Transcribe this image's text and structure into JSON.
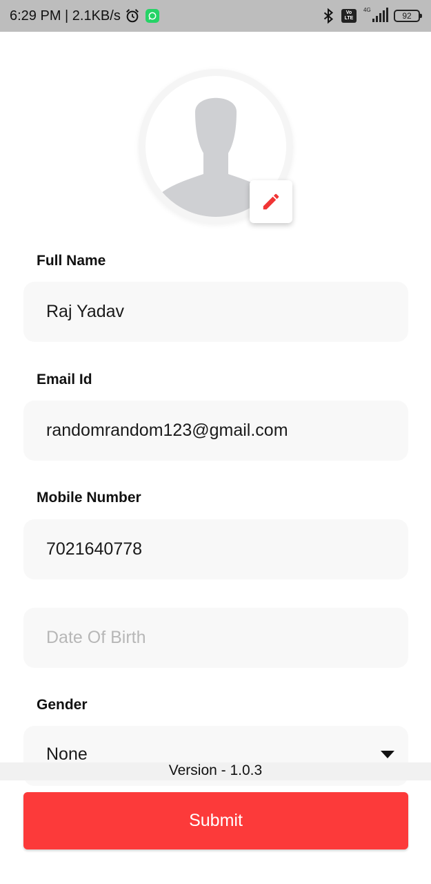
{
  "status_bar": {
    "time_speed": "6:29 PM | 2.1KB/s",
    "network_type": "4G",
    "volte_top": "Vo",
    "volte_bottom": "LTE",
    "battery": "92",
    "icons": [
      "alarm-icon",
      "whatsapp-icon",
      "bluetooth-icon",
      "volte-icon",
      "signal-icon",
      "battery-icon"
    ]
  },
  "profile": {
    "avatar_icon": "person-silhouette-icon",
    "edit_icon": "pencil-icon",
    "accent_color": "#f03535"
  },
  "form": {
    "full_name": {
      "label": "Full Name",
      "value": "Raj Yadav"
    },
    "email": {
      "label": "Email Id",
      "value": "randomrandom123@gmail.com"
    },
    "mobile": {
      "label": "Mobile Number",
      "value": "7021640778"
    },
    "dob": {
      "placeholder": "Date Of Birth",
      "value": ""
    },
    "gender": {
      "label": "Gender",
      "selected": "None"
    }
  },
  "footer": {
    "version": "Version - 1.0.3",
    "submit_label": "Submit",
    "submit_color": "#fc3a3a"
  }
}
